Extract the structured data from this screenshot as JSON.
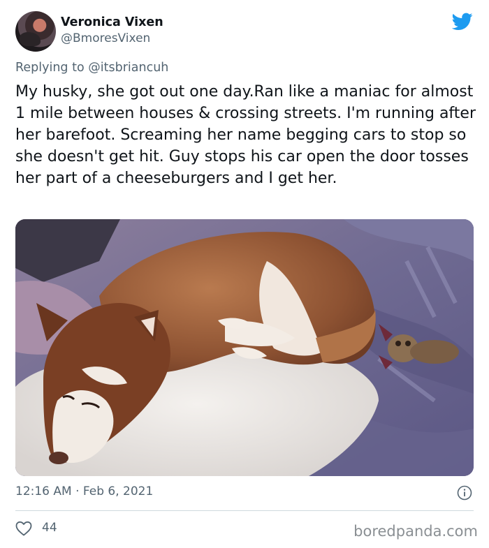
{
  "author": {
    "display_name": "Veronica Vixen",
    "handle": "@BmoresVixen",
    "avatar_icon": "user-avatar"
  },
  "platform": {
    "logo_icon": "twitter-bird-icon",
    "brand_color": "#1d9bf0"
  },
  "reply": {
    "prefix": "Replying to",
    "mention": "@itsbriancuh"
  },
  "tweet": {
    "text": "My husky, she got out one day.Ran like a maniac for almost 1 mile between houses & crossing streets.  I'm running after her barefoot. Screaming her name begging cars to stop so she doesn't get hit. Guy stops his car open the door tosses her part of a cheeseburgers and I get her.",
    "time": "12:16 AM",
    "separator": "·",
    "date": "Feb 6, 2021"
  },
  "engagement": {
    "like_icon": "heart-icon",
    "likes": "44",
    "info_icon": "info-icon"
  },
  "watermark": "boredpanda.com",
  "colors": {
    "text_primary": "#0f1419",
    "text_secondary": "#536471",
    "divider": "#cfd9de"
  }
}
